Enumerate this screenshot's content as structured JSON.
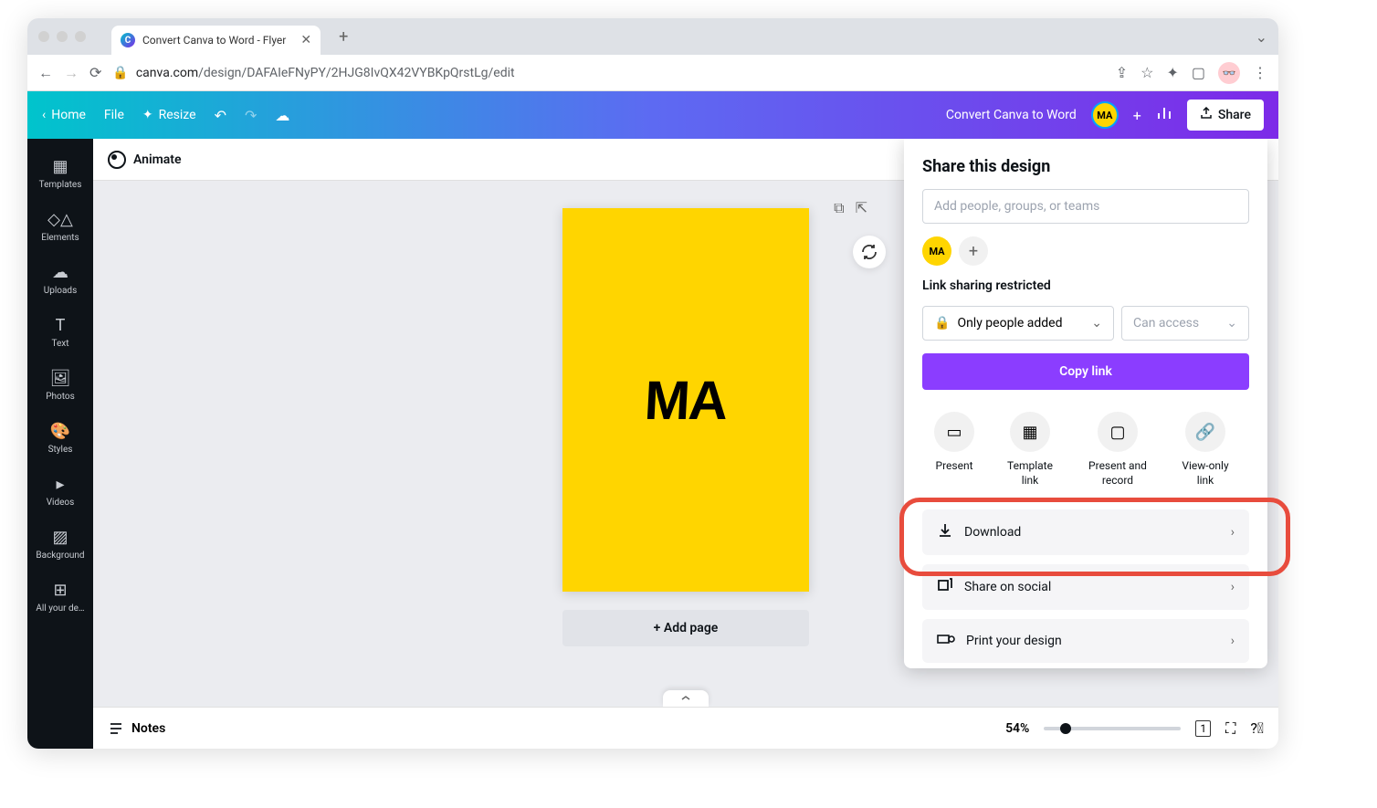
{
  "browser": {
    "tab_title": "Convert Canva to Word - Flyer",
    "url_host": "canva.com",
    "url_path": "/design/DAFAIeFNyPY/2HJG8IvQX42VYBKpQrstLg/edit"
  },
  "header": {
    "home": "Home",
    "file": "File",
    "resize": "Resize",
    "title": "Convert Canva to Word",
    "avatar": "MA",
    "share": "Share"
  },
  "sidebar": {
    "items": [
      {
        "label": "Templates"
      },
      {
        "label": "Elements"
      },
      {
        "label": "Uploads"
      },
      {
        "label": "Text"
      },
      {
        "label": "Photos"
      },
      {
        "label": "Styles"
      },
      {
        "label": "Videos"
      },
      {
        "label": "Background"
      },
      {
        "label": "All your de…"
      }
    ]
  },
  "toolbar": {
    "animate": "Animate"
  },
  "canvas": {
    "text": "MA",
    "add_page": "+ Add page"
  },
  "bottom": {
    "notes": "Notes",
    "zoom": "54%",
    "page_count": "1"
  },
  "panel": {
    "title": "Share this design",
    "people_placeholder": "Add people, groups, or teams",
    "avatar": "MA",
    "restrict": "Link sharing restricted",
    "select_main": "Only people added",
    "select_secondary": "Can access",
    "copy_link": "Copy link",
    "options": [
      {
        "label": "Present"
      },
      {
        "label": "Template link"
      },
      {
        "label": "Present and record"
      },
      {
        "label": "View-only link"
      }
    ],
    "actions": [
      {
        "label": "Download"
      },
      {
        "label": "Share on social"
      },
      {
        "label": "Print your design"
      }
    ]
  }
}
